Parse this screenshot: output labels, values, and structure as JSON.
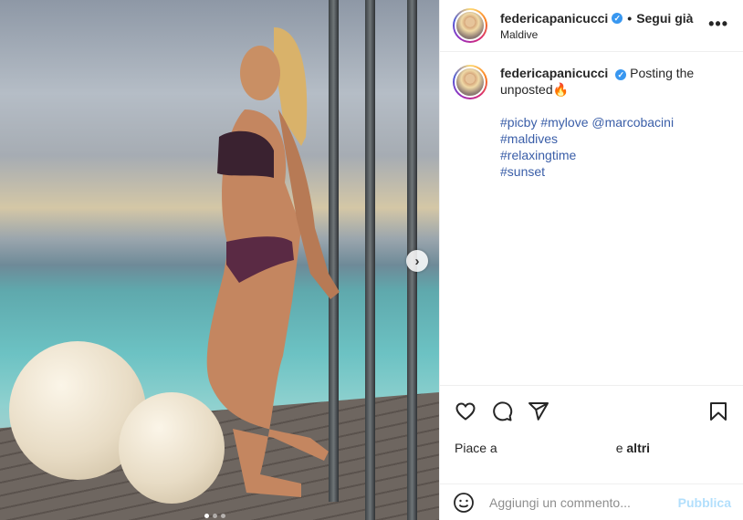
{
  "post": {
    "username": "federicapanicucci",
    "verified_mark": "✓",
    "separator": "•",
    "follow_label": "Segui già",
    "location": "Maldive",
    "more_icon": "more-options-icon",
    "more_glyph": "•••"
  },
  "caption": {
    "username": "federicapanicucci",
    "text": "Posting the unposted🔥",
    "hashtags": [
      "#picby #mylove @marcobacini",
      "#maldives",
      "#relaxingtime",
      "#sunset"
    ]
  },
  "actions": {
    "icons": [
      "heart-icon",
      "comment-icon",
      "share-icon",
      "bookmark-icon"
    ]
  },
  "likes": {
    "prefix": "Piace a",
    "and": "e",
    "others": "altri"
  },
  "comment": {
    "placeholder": "Aggiungi un commento...",
    "publish_label": "Pubblica"
  },
  "carousel": {
    "next_glyph": "›",
    "slide_count": 3,
    "active_index": 0
  },
  "colors": {
    "verified": "#3897f0",
    "hashtag": "#3a5ea8",
    "publish": "#b2dffc",
    "text": "#262626"
  }
}
